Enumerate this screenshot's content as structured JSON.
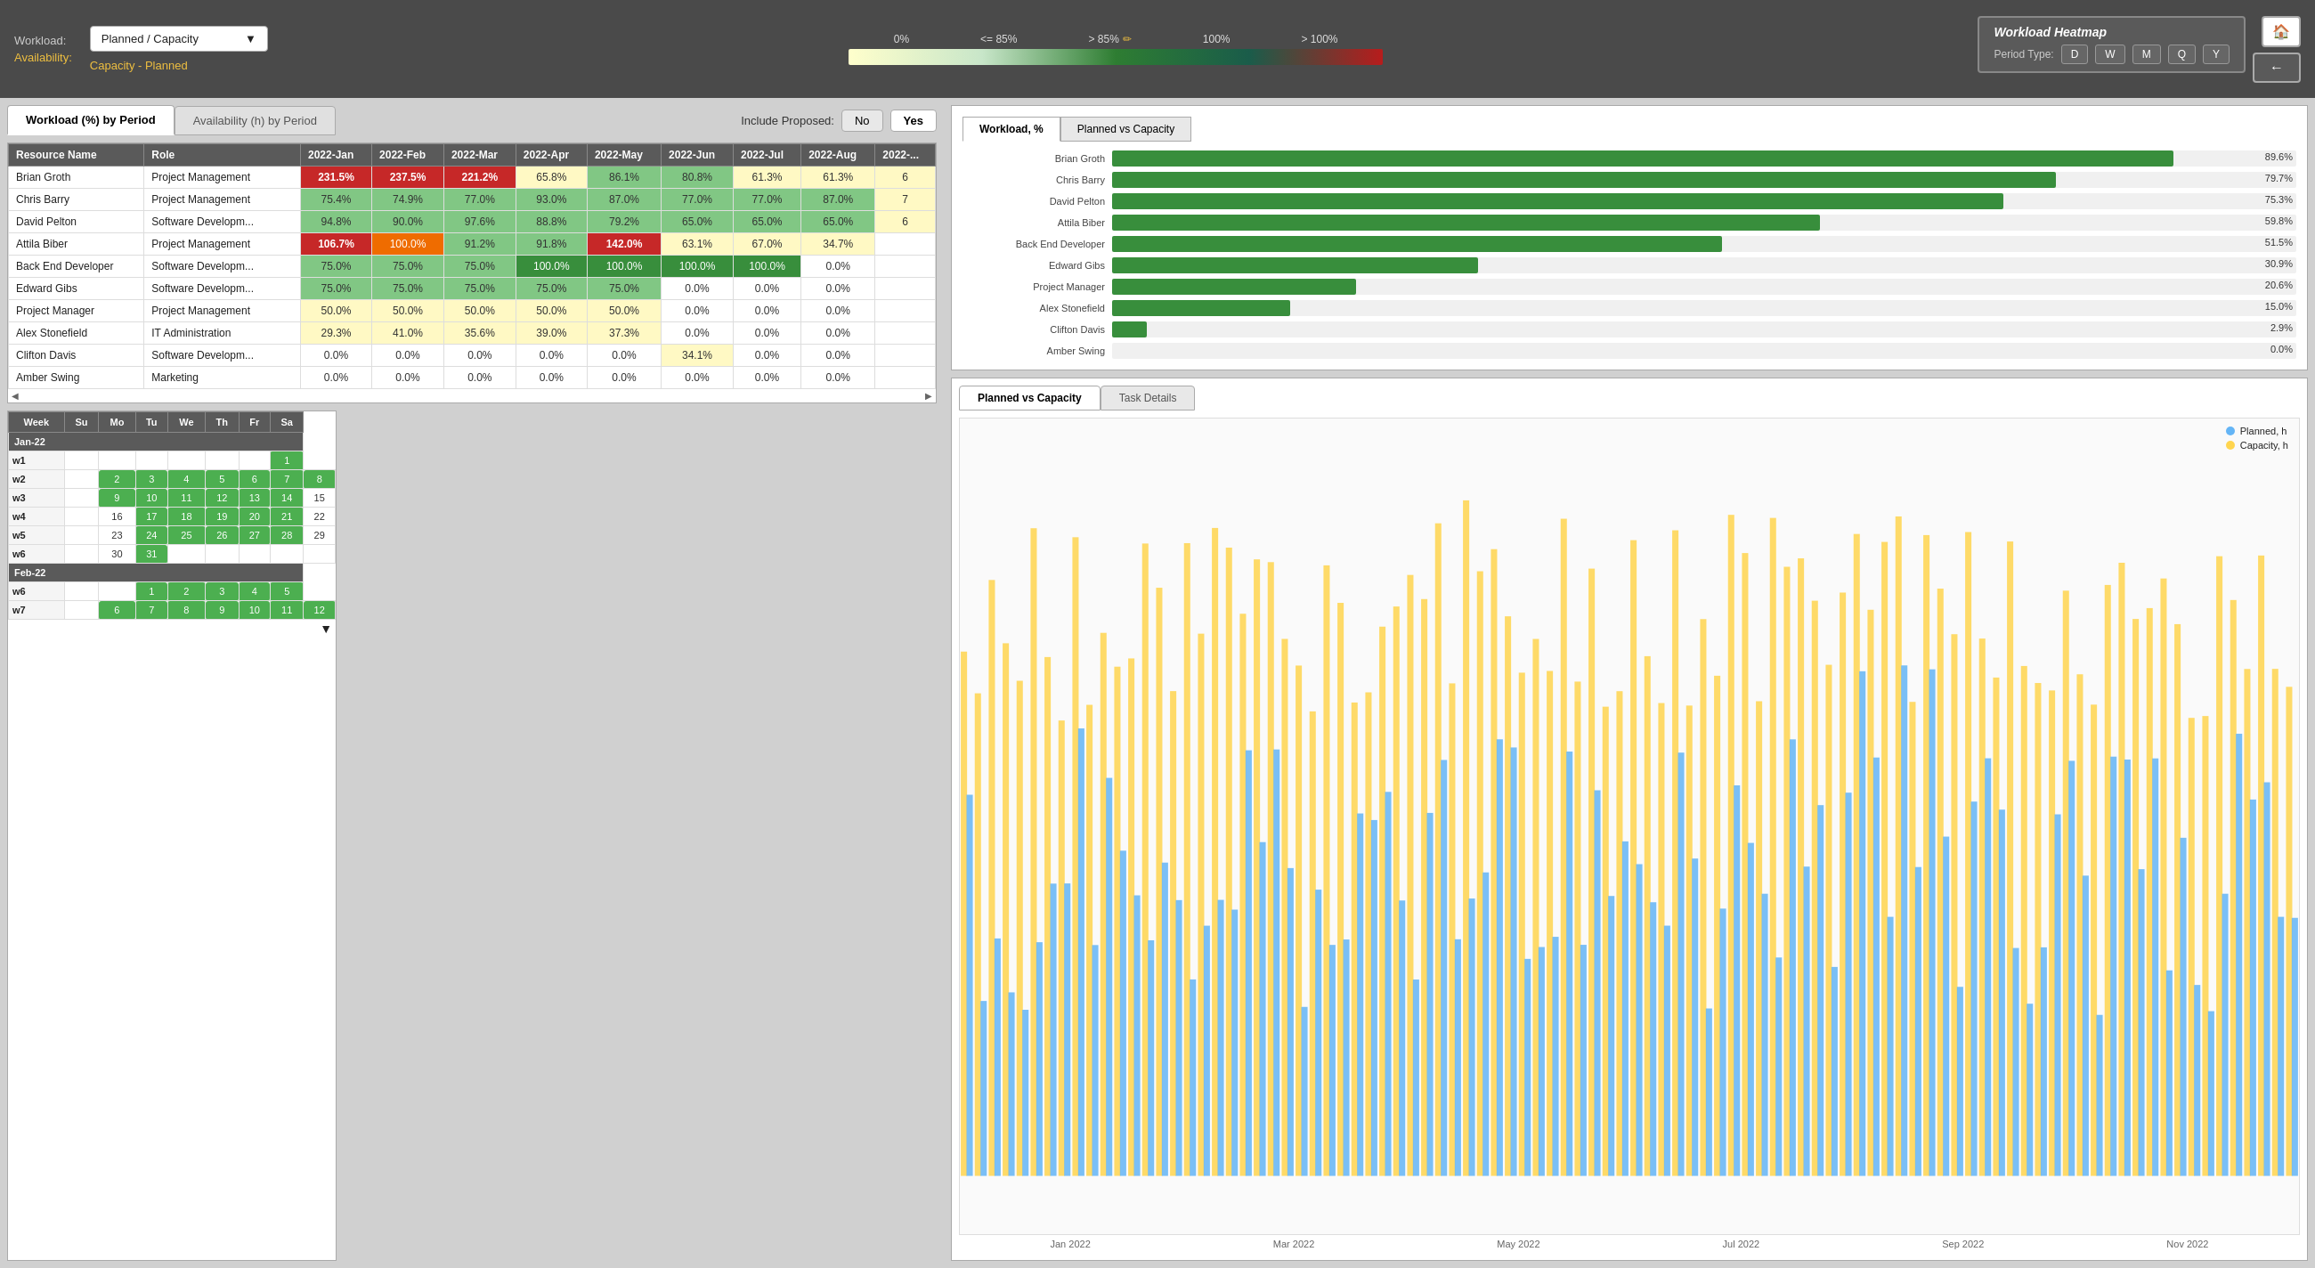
{
  "header": {
    "workload_label": "Workload:",
    "workload_value": "Planned / Capacity",
    "availability_label": "Availability:",
    "availability_value": "Capacity - Planned",
    "legend": {
      "labels": [
        "0%",
        "<= 85%",
        "> 85%",
        "100%",
        "> 100%"
      ],
      "pencil": "✏"
    },
    "heatmap_title": "Workload Heatmap",
    "period_type_label": "Period Type:",
    "period_buttons": [
      "D",
      "W",
      "M",
      "Q",
      "Y"
    ],
    "home_icon": "🏠",
    "back_icon": "←"
  },
  "tabs": {
    "workload": "Workload (%) by Period",
    "availability": "Availability (h) by Period"
  },
  "include_proposed": {
    "label": "Include Proposed:",
    "no": "No",
    "yes": "Yes"
  },
  "table": {
    "columns": [
      "Resource Name",
      "Role",
      "2022-Jan",
      "2022-Feb",
      "2022-Mar",
      "2022-Apr",
      "2022-May",
      "2022-Jun",
      "2022-Jul",
      "2022-Aug",
      "2022-..."
    ],
    "rows": [
      {
        "name": "Brian Groth",
        "role": "Project Management",
        "values": [
          "231.5%",
          "237.5%",
          "221.2%",
          "65.8%",
          "86.1%",
          "80.8%",
          "61.3%",
          "61.3%",
          "6"
        ],
        "colors": [
          "red",
          "red",
          "red",
          "pale",
          "light-green",
          "light-green",
          "pale-yellow",
          "pale-yellow",
          "pale-yellow"
        ]
      },
      {
        "name": "Chris Barry",
        "role": "Project Management",
        "values": [
          "75.4%",
          "74.9%",
          "77.0%",
          "93.0%",
          "87.0%",
          "77.0%",
          "77.0%",
          "87.0%",
          "7"
        ],
        "colors": [
          "light-green",
          "light-green",
          "light-green",
          "light-green",
          "light-green",
          "light-green",
          "light-green",
          "light-green",
          "pale-yellow"
        ]
      },
      {
        "name": "David Pelton",
        "role": "Software Developm...",
        "values": [
          "94.8%",
          "90.0%",
          "97.6%",
          "88.8%",
          "79.2%",
          "65.0%",
          "65.0%",
          "65.0%",
          "6"
        ],
        "colors": [
          "light-green",
          "light-green",
          "light-green",
          "light-green",
          "light-green",
          "light-green",
          "light-green",
          "light-green",
          "pale-yellow"
        ]
      },
      {
        "name": "Attila Biber",
        "role": "Project Management",
        "values": [
          "106.7%",
          "100.0%",
          "91.2%",
          "91.8%",
          "142.0%",
          "63.1%",
          "67.0%",
          "34.7%",
          ""
        ],
        "colors": [
          "red",
          "orange",
          "light-green",
          "light-green",
          "red",
          "pale-yellow",
          "pale-yellow",
          "pale-yellow",
          "white"
        ]
      },
      {
        "name": "Back End Developer",
        "role": "Software Developm...",
        "values": [
          "75.0%",
          "75.0%",
          "75.0%",
          "100.0%",
          "100.0%",
          "100.0%",
          "100.0%",
          "0.0%",
          ""
        ],
        "colors": [
          "light-green",
          "light-green",
          "light-green",
          "green",
          "green",
          "green",
          "green",
          "white",
          "white"
        ]
      },
      {
        "name": "Edward Gibs",
        "role": "Software Developm...",
        "values": [
          "75.0%",
          "75.0%",
          "75.0%",
          "75.0%",
          "75.0%",
          "0.0%",
          "0.0%",
          "0.0%",
          ""
        ],
        "colors": [
          "light-green",
          "light-green",
          "light-green",
          "light-green",
          "light-green",
          "white",
          "white",
          "white",
          "white"
        ]
      },
      {
        "name": "Project Manager",
        "role": "Project Management",
        "values": [
          "50.0%",
          "50.0%",
          "50.0%",
          "50.0%",
          "50.0%",
          "0.0%",
          "0.0%",
          "0.0%",
          ""
        ],
        "colors": [
          "pale-yellow",
          "pale-yellow",
          "pale-yellow",
          "pale-yellow",
          "pale-yellow",
          "white",
          "white",
          "white",
          "white"
        ]
      },
      {
        "name": "Alex Stonefield",
        "role": "IT Administration",
        "values": [
          "29.3%",
          "41.0%",
          "35.6%",
          "39.0%",
          "37.3%",
          "0.0%",
          "0.0%",
          "0.0%",
          ""
        ],
        "colors": [
          "pale-yellow",
          "pale-yellow",
          "pale-yellow",
          "pale-yellow",
          "pale-yellow",
          "white",
          "white",
          "white",
          "white"
        ]
      },
      {
        "name": "Clifton Davis",
        "role": "Software Developm...",
        "values": [
          "0.0%",
          "0.0%",
          "0.0%",
          "0.0%",
          "0.0%",
          "34.1%",
          "0.0%",
          "0.0%",
          ""
        ],
        "colors": [
          "white",
          "white",
          "white",
          "white",
          "white",
          "pale-yellow",
          "white",
          "white",
          "white"
        ]
      },
      {
        "name": "Amber Swing",
        "role": "Marketing",
        "values": [
          "0.0%",
          "0.0%",
          "0.0%",
          "0.0%",
          "0.0%",
          "0.0%",
          "0.0%",
          "0.0%",
          ""
        ],
        "colors": [
          "white",
          "white",
          "white",
          "white",
          "white",
          "white",
          "white",
          "white",
          "white"
        ]
      }
    ]
  },
  "calendar": {
    "headers": [
      "Week",
      "Su",
      "Mo",
      "Tu",
      "We",
      "Th",
      "Fr",
      "Sa"
    ],
    "months": [
      {
        "name": "Jan-22",
        "weeks": [
          {
            "week": "w1",
            "days": [
              "",
              "",
              "",
              "",
              "",
              "",
              "1"
            ]
          },
          {
            "week": "w2",
            "days": [
              "",
              "2",
              "3",
              "4",
              "5",
              "6",
              "7",
              "8"
            ]
          },
          {
            "week": "w3",
            "days": [
              "",
              "9",
              "10",
              "11",
              "12",
              "13",
              "14",
              "15"
            ]
          },
          {
            "week": "w4",
            "days": [
              "",
              "16",
              "17",
              "18",
              "19",
              "20",
              "21",
              "22"
            ]
          },
          {
            "week": "w5",
            "days": [
              "",
              "23",
              "24",
              "25",
              "26",
              "27",
              "28",
              "29"
            ]
          },
          {
            "week": "w6",
            "days": [
              "",
              "30",
              "31",
              "",
              "",
              "",
              "",
              ""
            ]
          }
        ]
      },
      {
        "name": "Feb-22",
        "weeks": [
          {
            "week": "w6",
            "days": [
              "",
              "",
              "1",
              "2",
              "3",
              "4",
              "5"
            ]
          },
          {
            "week": "w7",
            "days": [
              "",
              "6",
              "7",
              "8",
              "9",
              "10",
              "11",
              "12"
            ]
          }
        ]
      }
    ],
    "green_days": [
      "3",
      "4",
      "5",
      "6",
      "7",
      "10",
      "11",
      "12",
      "13",
      "14",
      "17",
      "18",
      "19",
      "20",
      "21",
      "24",
      "25",
      "26",
      "27",
      "28",
      "31",
      "1",
      "2",
      "3",
      "4",
      "7",
      "8",
      "9",
      "10",
      "11"
    ]
  },
  "bar_chart": {
    "tabs": [
      "Workload, %",
      "Planned vs Capacity"
    ],
    "active_tab": "Workload, %",
    "rows": [
      {
        "label": "Brian Groth",
        "value": 89.6,
        "display": "89.6%"
      },
      {
        "label": "Chris Barry",
        "value": 79.7,
        "display": "79.7%"
      },
      {
        "label": "David Pelton",
        "value": 75.3,
        "display": "75.3%"
      },
      {
        "label": "Attila Biber",
        "value": 59.8,
        "display": "59.8%"
      },
      {
        "label": "Back End Developer",
        "value": 51.5,
        "display": "51.5%"
      },
      {
        "label": "Edward Gibs",
        "value": 30.9,
        "display": "30.9%"
      },
      {
        "label": "Project Manager",
        "value": 20.6,
        "display": "20.6%"
      },
      {
        "label": "Alex Stonefield",
        "value": 15.0,
        "display": "15.0%"
      },
      {
        "label": "Clifton Davis",
        "value": 2.9,
        "display": "2.9%"
      },
      {
        "label": "Amber Swing",
        "value": 0.0,
        "display": "0.0%"
      }
    ]
  },
  "bottom_chart": {
    "tabs": [
      "Planned vs Capacity",
      "Task Details"
    ],
    "active_tab": "Planned vs Capacity",
    "legend": {
      "planned_label": "Planned, h",
      "planned_color": "#64b5f6",
      "capacity_label": "Capacity, h",
      "capacity_color": "#ffd54f"
    },
    "x_labels": [
      "Jan 2022",
      "Mar 2022",
      "May 2022",
      "Jul 2022",
      "Sep 2022",
      "Nov 2022"
    ]
  }
}
